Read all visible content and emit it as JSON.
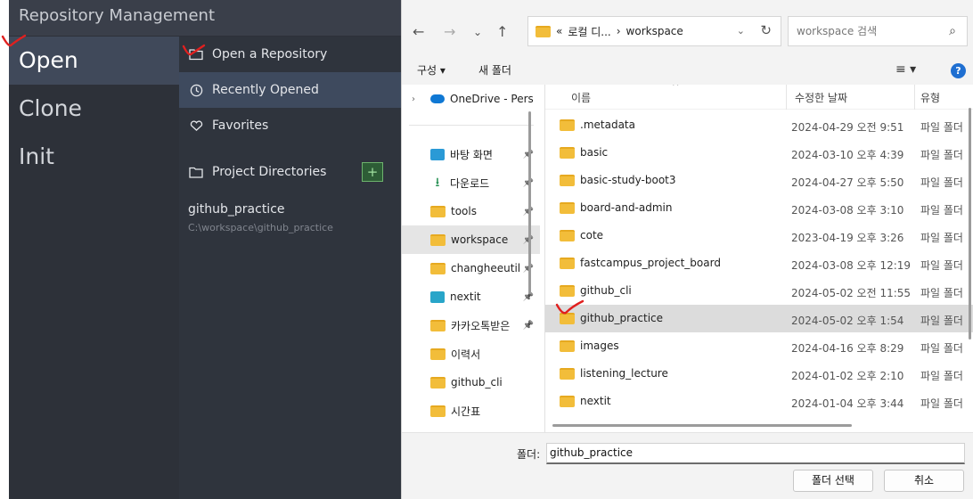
{
  "app": {
    "title": "Repository Management",
    "nav": [
      "Open",
      "Clone",
      "Init"
    ],
    "sub": {
      "open_repo": "Open a Repository",
      "recently_opened": "Recently Opened",
      "favorites": "Favorites",
      "project_dirs": "Project Directories",
      "add_label": "+"
    },
    "recent": {
      "name": "github_practice",
      "path": "C:\\workspace\\github_practice"
    }
  },
  "dialog": {
    "breadcrumb_prefix": "«",
    "breadcrumb_parent": "로컬 디...",
    "breadcrumb_sep": "›",
    "breadcrumb_current": "workspace",
    "search_placeholder": "workspace 검색",
    "cmd_organize": "구성 ▾",
    "cmd_new_folder": "새 폴더",
    "view_icon": "≡ ▾",
    "help": "?",
    "tree": [
      {
        "label": "OneDrive - Pers",
        "icon": "cloud-icon",
        "arrow": "›"
      },
      {
        "label": "바탕 화면",
        "icon": "desktop-icon",
        "pin": true
      },
      {
        "label": "다운로드",
        "icon": "download-icon",
        "pin": true
      },
      {
        "label": "tools",
        "icon": "folder-icon",
        "pin": true
      },
      {
        "label": "workspace",
        "icon": "folder-icon",
        "pin": true,
        "selected": true
      },
      {
        "label": "changheeutil",
        "icon": "folder-icon",
        "pin": true
      },
      {
        "label": "nextit",
        "icon": "monitor-icon",
        "pin": true
      },
      {
        "label": "카카오톡받은",
        "icon": "folder-icon",
        "pin": true
      },
      {
        "label": "이력서",
        "icon": "folder-icon"
      },
      {
        "label": "github_cli",
        "icon": "folder-icon"
      },
      {
        "label": "시간표",
        "icon": "folder-icon"
      }
    ],
    "columns": {
      "name": "이름",
      "modified": "수정한 날짜",
      "type": "유형"
    },
    "rows": [
      {
        "name": ".metadata",
        "date": "2024-04-29 오전 9:51",
        "type": "파일 폴더"
      },
      {
        "name": "basic",
        "date": "2024-03-10 오후 4:39",
        "type": "파일 폴더"
      },
      {
        "name": "basic-study-boot3",
        "date": "2024-04-27 오후 5:50",
        "type": "파일 폴더"
      },
      {
        "name": "board-and-admin",
        "date": "2024-03-08 오후 3:10",
        "type": "파일 폴더"
      },
      {
        "name": "cote",
        "date": "2023-04-19 오후 3:26",
        "type": "파일 폴더"
      },
      {
        "name": "fastcampus_project_board",
        "date": "2024-03-08 오후 12:19",
        "type": "파일 폴더"
      },
      {
        "name": "github_cli",
        "date": "2024-05-02 오전 11:55",
        "type": "파일 폴더"
      },
      {
        "name": "github_practice",
        "date": "2024-05-02 오후 1:54",
        "type": "파일 폴더",
        "selected": true
      },
      {
        "name": "images",
        "date": "2024-04-16 오후 8:29",
        "type": "파일 폴더"
      },
      {
        "name": "listening_lecture",
        "date": "2024-01-02 오후 2:10",
        "type": "파일 폴더"
      },
      {
        "name": "nextit",
        "date": "2024-01-04 오후 3:44",
        "type": "파일 폴더"
      }
    ],
    "folder_label": "폴더:",
    "folder_value": "github_practice",
    "select_button": "폴더 선택",
    "cancel_button": "취소"
  },
  "colors": {
    "accent": "#40495a",
    "folder": "#f2bd3a",
    "annotation": "#e0201f"
  }
}
